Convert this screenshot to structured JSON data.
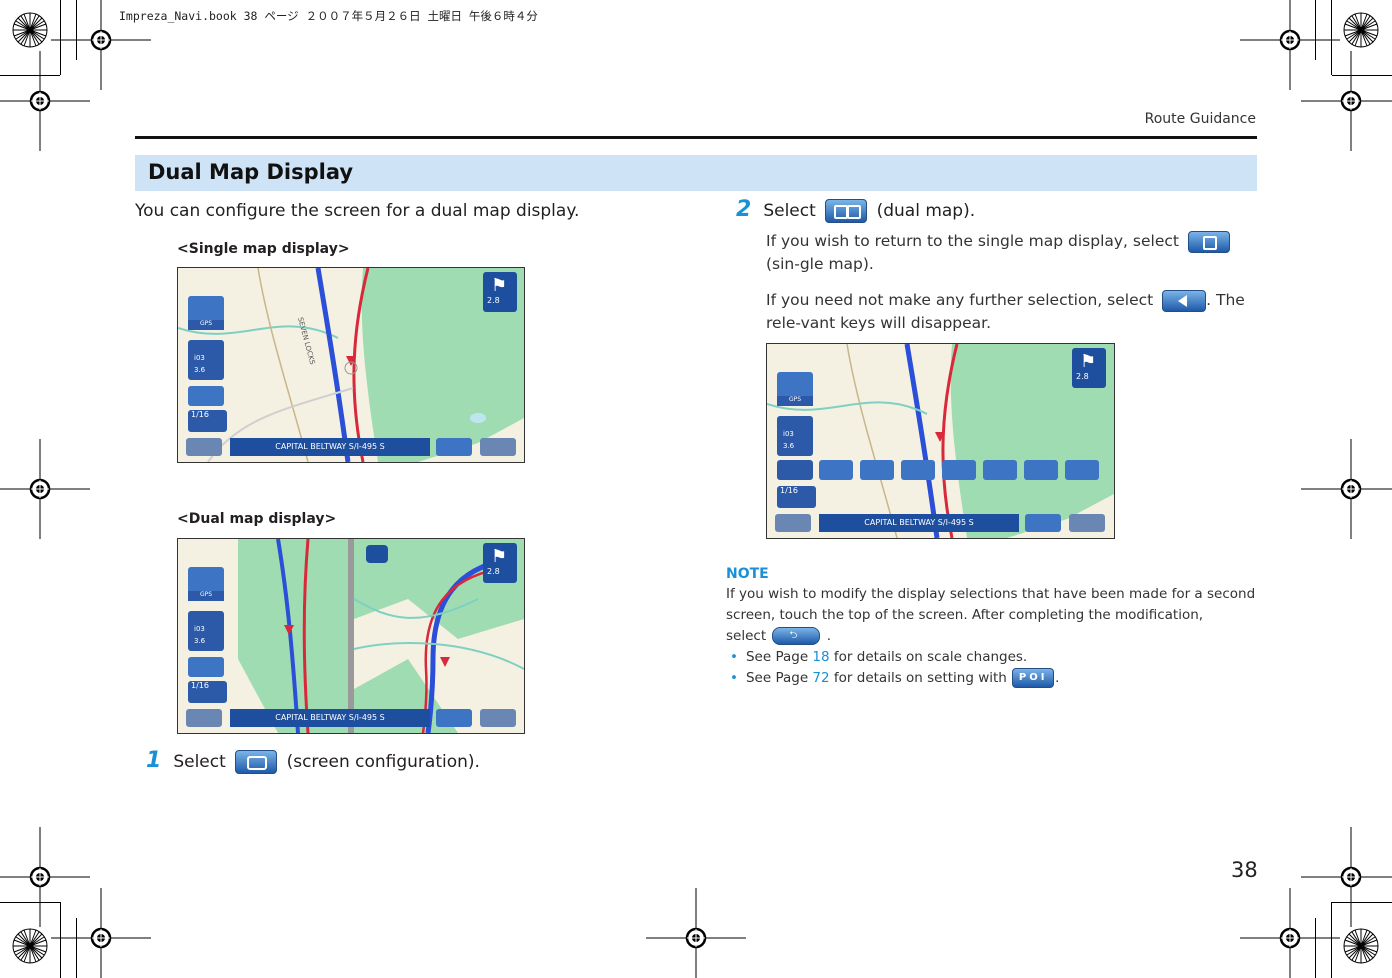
{
  "print_header": "Impreza_Navi.book  38 ページ  ２００７年５月２６日  土曜日  午後６時４分",
  "running_head": "Route Guidance",
  "section_title": "Dual Map Display",
  "intro": "You can configure the screen for a dual map display.",
  "captions": {
    "single": "<Single map display>",
    "dual": "<Dual map display>"
  },
  "map_labels": {
    "road_banner": "CAPITAL BELTWAY S/I-495 S",
    "distance_top": "2.8",
    "distance_mid": "3.6",
    "route_num": "i03",
    "scale": "1/16",
    "gps": "GPS",
    "street": "SEVEN LOCKS"
  },
  "step1": {
    "num": "1",
    "before": "Select",
    "after": "(screen configuration)."
  },
  "step2": {
    "num": "2",
    "before": "Select",
    "after": "(dual map).",
    "p1_before": "If you wish to return to the single map display, select",
    "p1_after": "(sin-gle map).",
    "p2_before": "If you need not make any further selection, select",
    "p2_after": ". The rele-vant keys will disappear."
  },
  "note": {
    "title": "NOTE",
    "text": "If you wish to modify the display selections that have been made for a second screen, touch the top of the screen. After completing the modification,",
    "select_word": "select",
    "select_end": ".",
    "b1_pre": "See Page",
    "b1_link": "18",
    "b1_post": "for details on scale changes.",
    "b2_pre": "See Page",
    "b2_link": "72",
    "b2_post": "for details on setting with",
    "b2_end": ".",
    "poi_label": "POI"
  },
  "page_number": "38",
  "colors": {
    "accent": "#1a90d8",
    "title_bar": "#cfe3f6",
    "map_green": "#9fdcb2",
    "route_blue": "#2b4fd8",
    "road_red": "#d9283a"
  }
}
